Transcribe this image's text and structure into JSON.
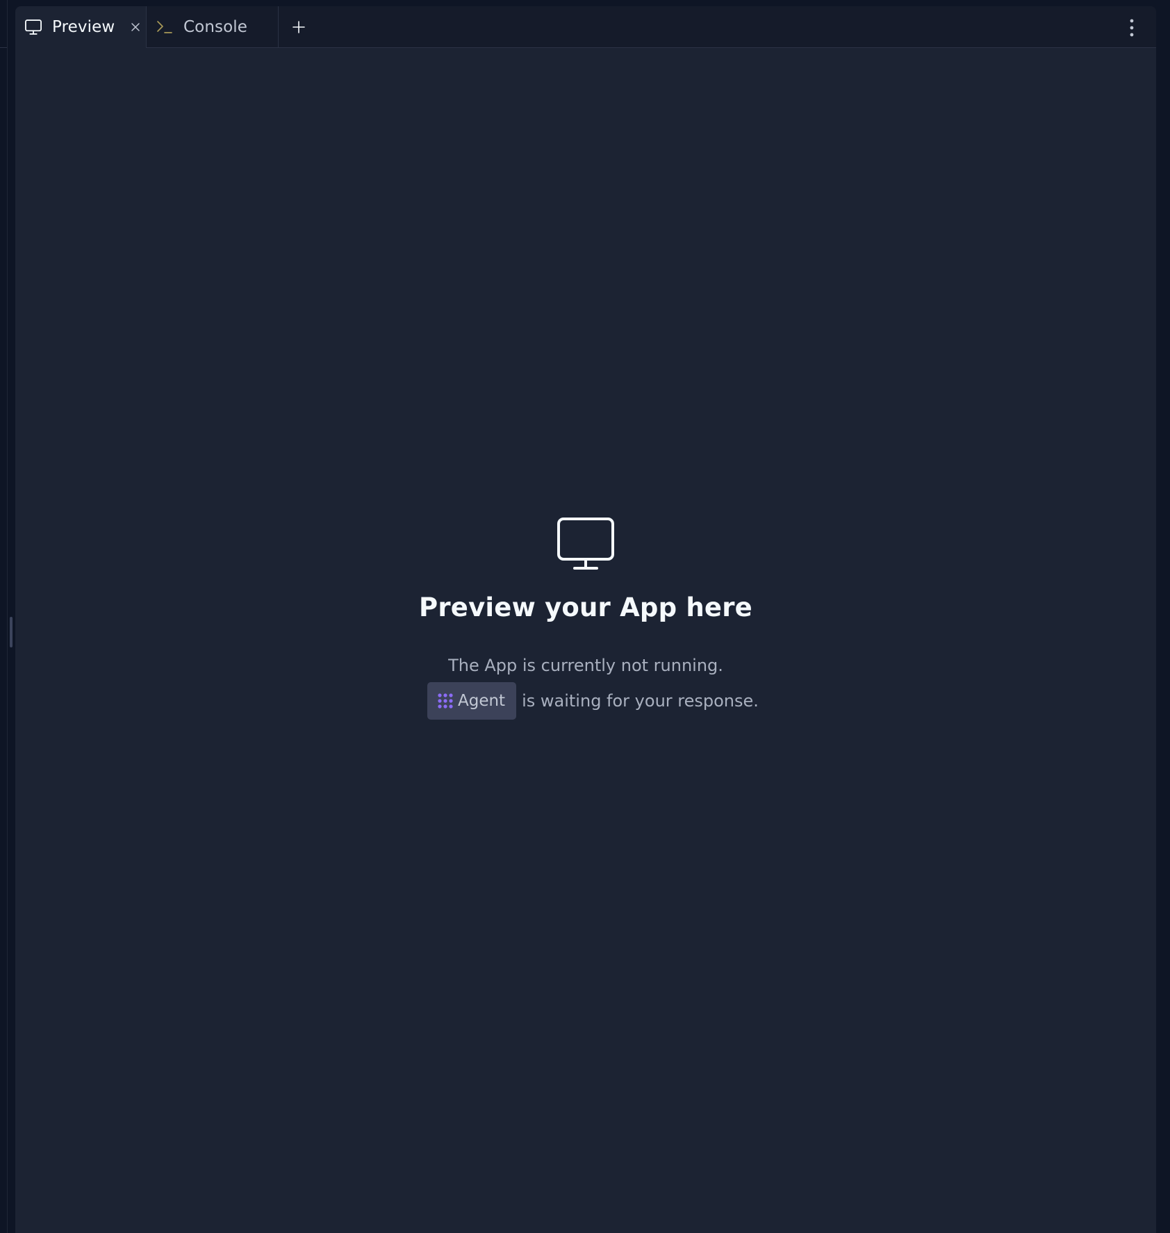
{
  "tabs": [
    {
      "label": "Preview",
      "icon": "monitor-icon",
      "active": true,
      "closable": true
    },
    {
      "label": "Console",
      "icon": "terminal-prompt-icon",
      "active": false,
      "closable": false
    }
  ],
  "toolbar": {
    "add_tab_icon": "plus-icon",
    "menu_icon": "vertical-ellipsis-icon"
  },
  "empty_state": {
    "icon": "monitor-icon",
    "title": "Preview your App here",
    "line1": "The App is currently not running.",
    "agent_label": "Agent",
    "agent_icon": "agent-dots-icon",
    "line2_suffix": "is waiting for your response."
  },
  "colors": {
    "background": "#1c2333",
    "tabbar": "#151b2a",
    "agent_accent": "#8b6cf6",
    "console_icon": "#a99a58"
  }
}
